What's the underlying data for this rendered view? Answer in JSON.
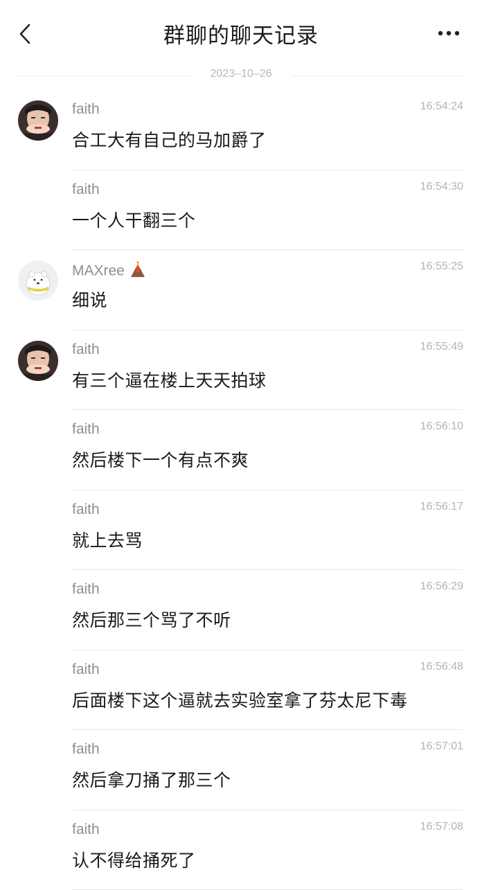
{
  "header": {
    "title": "群聊的聊天记录",
    "back_icon": "chevron-left-icon",
    "more_icon": "more-horizontal-icon"
  },
  "date_separator": "2023–10–26",
  "messages": [
    {
      "sender": "faith",
      "time": "16:54:24",
      "text": "合工大有自己的马加爵了",
      "avatar": "faith"
    },
    {
      "sender": "faith",
      "time": "16:54:30",
      "text": "一个人干翻三个",
      "avatar": ""
    },
    {
      "sender": "MAXree",
      "time": "16:55:25",
      "text": "细说",
      "avatar": "maxree",
      "badge_icon": "volcano-emoji-icon"
    },
    {
      "sender": "faith",
      "time": "16:55:49",
      "text": "有三个逼在楼上天天拍球",
      "avatar": "faith"
    },
    {
      "sender": "faith",
      "time": "16:56:10",
      "text": "然后楼下一个有点不爽",
      "avatar": ""
    },
    {
      "sender": "faith",
      "time": "16:56:17",
      "text": "就上去骂",
      "avatar": ""
    },
    {
      "sender": "faith",
      "time": "16:56:29",
      "text": "然后那三个骂了不听",
      "avatar": ""
    },
    {
      "sender": "faith",
      "time": "16:56:48",
      "text": "后面楼下这个逼就去实验室拿了芬太尼下毒",
      "avatar": ""
    },
    {
      "sender": "faith",
      "time": "16:57:01",
      "text": "然后拿刀捅了那三个",
      "avatar": ""
    },
    {
      "sender": "faith",
      "time": "16:57:08",
      "text": "认不得给捅死了",
      "avatar": ""
    }
  ]
}
